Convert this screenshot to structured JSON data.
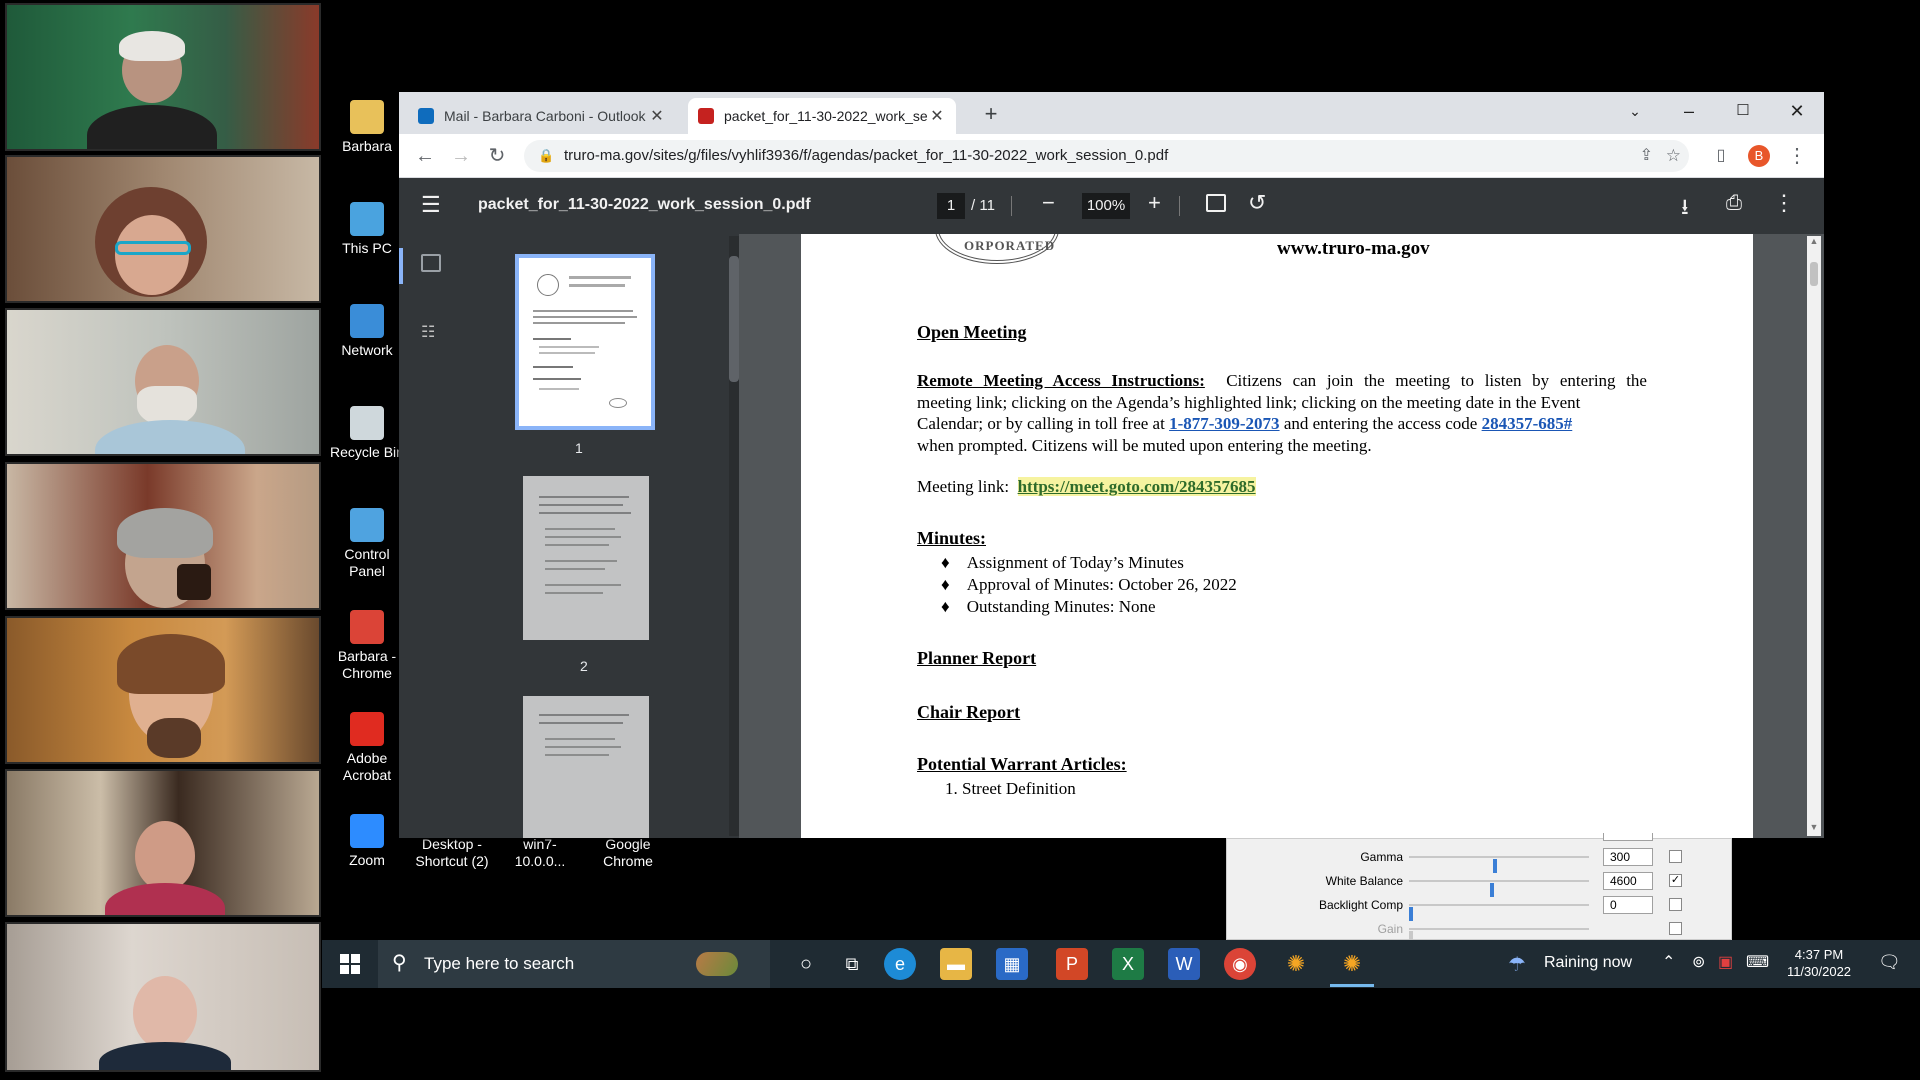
{
  "desktop_icons": [
    {
      "label": "Barbara",
      "icon": "user-folder-icon",
      "color": "#e8c15a"
    },
    {
      "label": "This PC",
      "icon": "computer-icon",
      "color": "#4aa3df"
    },
    {
      "label": "Network",
      "icon": "network-icon",
      "color": "#3a8dd8"
    },
    {
      "label": "Recycle Bin",
      "icon": "recycle-bin-icon",
      "color": "#cfd8dc"
    },
    {
      "label": "Control Panel",
      "icon": "control-panel-icon",
      "color": "#4fa3e0"
    },
    {
      "label": "Barbara - Chrome",
      "icon": "chrome-icon",
      "color": "#db4437"
    },
    {
      "label": "Adobe Acrobat",
      "icon": "acrobat-icon",
      "color": "#e02b20"
    },
    {
      "label": "Zoom",
      "icon": "zoom-icon",
      "color": "#2d8cff"
    }
  ],
  "desktop_icons_row": [
    {
      "label": "Desktop - Shortcut (2)",
      "icon": "shortcut-icon",
      "color": "#4aa3df"
    },
    {
      "label": "win7-10.0.0...",
      "icon": "folder-icon",
      "color": "#e8c15a"
    },
    {
      "label": "Google Chrome",
      "icon": "chrome-icon",
      "color": "#db4437"
    }
  ],
  "browser": {
    "tabs": [
      {
        "label": "Mail - Barbara Carboni - Outlook",
        "icon": "outlook-icon",
        "color": "#0f6cbd"
      },
      {
        "label": "packet_for_11-30-2022_work_se",
        "icon": "pdf-link-icon",
        "color": "#c5221f"
      }
    ],
    "new_tab_symbol": "+",
    "url": "truro-ma.gov/sites/g/files/vyhlif3936/f/agendas/packet_for_11-30-2022_work_session_0.pdf",
    "profile_initial": "B"
  },
  "pdf": {
    "filename": "packet_for_11-30-2022_work_session_0.pdf",
    "current_page": "1",
    "total_pages": "/ 11",
    "zoom": "100%",
    "thumbnail_labels": [
      "1",
      "2"
    ]
  },
  "document": {
    "website": "www.truro-ma.gov",
    "open_meeting": "Open Meeting",
    "remote_heading": "Remote Meeting Access Instructions:",
    "remote_line1": "Citizens can join the meeting to listen by entering the",
    "remote_line2": "meeting link; clicking on the Agenda’s highlighted link; clicking on the meeting date in the Event",
    "remote_line3_pre": "Calendar; or by calling in toll free at ",
    "phone": "1-877-309-2073",
    "remote_line3_mid": " and entering the access code ",
    "access_code": "284357-685#",
    "remote_line4": "when prompted.  Citizens will be muted upon entering the meeting.",
    "meeting_link_label": "Meeting link:",
    "meeting_link": "https://meet.goto.com/284357685",
    "minutes_heading": "Minutes:",
    "minutes_items": [
      "Assignment of Today’s Minutes",
      "Approval of Minutes:  October 26, 2022",
      "Outstanding Minutes:  None"
    ],
    "planner_report": "Planner Report",
    "chair_report": "Chair Report",
    "warrant_heading": "Potential Warrant Articles:",
    "warrant_item": "1.   Street Definition"
  },
  "camera_settings": [
    {
      "label": "Gamma",
      "value": "300",
      "level": 0.48,
      "checked": false
    },
    {
      "label": "White Balance",
      "value": "4600",
      "level": 0.46,
      "checked": true
    },
    {
      "label": "Backlight Comp",
      "value": "0",
      "level": 0.0,
      "checked": false
    },
    {
      "label": "Gain",
      "value": "",
      "level": 0.0,
      "checked": false
    }
  ],
  "taskbar": {
    "search_placeholder": "Type here to search",
    "weather": "Raining now",
    "time": "4:37 PM",
    "date": "11/30/2022"
  }
}
